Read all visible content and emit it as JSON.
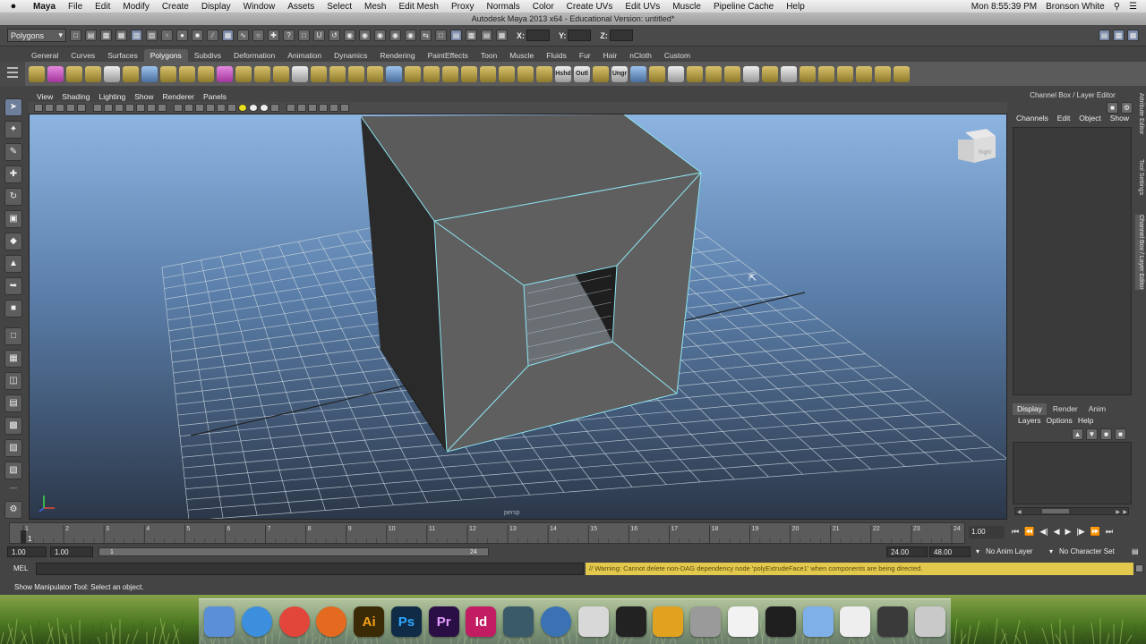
{
  "mac_menu": {
    "apple": "",
    "items": [
      "Maya",
      "File",
      "Edit",
      "Modify",
      "Create",
      "Display",
      "Window",
      "Assets",
      "Select",
      "Mesh",
      "Edit Mesh",
      "Proxy",
      "Normals",
      "Color",
      "Create UVs",
      "Edit UVs",
      "Muscle",
      "Pipeline Cache",
      "Help"
    ],
    "clock": "Mon 8:55:39 PM",
    "user": "Bronson White"
  },
  "window_title": "Autodesk Maya 2013 x64 - Educational Version: untitled*",
  "status_line": {
    "mode": "Polygons",
    "x_label": "X:",
    "y_label": "Y:",
    "z_label": "Z:"
  },
  "shelf": {
    "tabs": [
      "General",
      "Curves",
      "Surfaces",
      "Polygons",
      "Subdivs",
      "Deformation",
      "Animation",
      "Dynamics",
      "Rendering",
      "PaintEffects",
      "Toon",
      "Muscle",
      "Fluids",
      "Fur",
      "Hair",
      "nCloth",
      "Custom"
    ],
    "active_tab": "Polygons",
    "labeled_icons": [
      "Hshd",
      "Outl",
      "Ungr"
    ]
  },
  "viewport": {
    "menu": [
      "View",
      "Shading",
      "Lighting",
      "Show",
      "Renderer",
      "Panels"
    ],
    "view_cube_label": "Right",
    "camera_label": "persp"
  },
  "channel_box": {
    "title": "Channel Box / Layer Editor",
    "menu": [
      "Channels",
      "Edit",
      "Object",
      "Show"
    ]
  },
  "side_tabs": [
    "Attribute Editor",
    "Tool Settings",
    "Channel Box / Layer Editor"
  ],
  "layer_editor": {
    "tabs": [
      "Display",
      "Render",
      "Anim"
    ],
    "active_tab": "Display",
    "menu": [
      "Layers",
      "Options",
      "Help"
    ]
  },
  "time_slider": {
    "ticks": [
      1,
      2,
      3,
      4,
      5,
      6,
      7,
      8,
      9,
      10,
      11,
      12,
      13,
      14,
      15,
      16,
      17,
      18,
      19,
      20,
      21,
      22,
      23,
      24
    ],
    "current_frame": 1,
    "current_time": "1.00"
  },
  "range_slider": {
    "start": "1.00",
    "range_start": "1.00",
    "bar_start": "1",
    "bar_end": "24",
    "range_end": "24.00",
    "end": "48.00",
    "anim_layer": "No Anim Layer",
    "character_set": "No Character Set"
  },
  "command_line": {
    "label": "MEL",
    "warning": "// Warning: Cannot delete non-DAG dependency node 'polyExtrudeFace1' when components are being directed."
  },
  "help_line": "Show Manipulator Tool: Select an object.",
  "dock": {
    "icons": [
      {
        "name": "finder-icon",
        "label": "",
        "color": "#5b8fd8"
      },
      {
        "name": "safari-icon",
        "label": "",
        "color": "#3b8fdc"
      },
      {
        "name": "chrome-icon",
        "label": "",
        "color": "#e2463b"
      },
      {
        "name": "firefox-icon",
        "label": "",
        "color": "#e46a1f"
      },
      {
        "name": "illustrator-icon",
        "label": "Ai",
        "color": "#3a2a05"
      },
      {
        "name": "photoshop-icon",
        "label": "Ps",
        "color": "#0f2b46"
      },
      {
        "name": "premiere-icon",
        "label": "Pr",
        "color": "#2a0f45"
      },
      {
        "name": "indesign-icon",
        "label": "Id",
        "color": "#c21d63"
      },
      {
        "name": "maya-icon",
        "label": "",
        "color": "#3a5a6a"
      },
      {
        "name": "network-icon",
        "label": "",
        "color": "#3a72b4"
      },
      {
        "name": "preview-icon",
        "label": "",
        "color": "#d8d8d8"
      },
      {
        "name": "terminal-icon",
        "label": "",
        "color": "#222222"
      },
      {
        "name": "word-icon",
        "label": "",
        "color": "#e0a21f"
      },
      {
        "name": "utility-icon",
        "label": "",
        "color": "#9a9a9a"
      },
      {
        "name": "document-icon",
        "label": "",
        "color": "#f2f2f2"
      },
      {
        "name": "activity-icon",
        "label": "",
        "color": "#1f1f1f"
      },
      {
        "name": "folder-icon",
        "label": "",
        "color": "#7fb0e8"
      },
      {
        "name": "text-icon",
        "label": "",
        "color": "#eeeeee"
      },
      {
        "name": "drive-icon",
        "label": "",
        "color": "#3a3a3a"
      },
      {
        "name": "trash-icon",
        "label": "",
        "color": "#c9c9c9"
      }
    ]
  },
  "colors": {
    "wire_highlight": "#8ee6f4",
    "grid_line": "#c7d3dc",
    "face_gray": "#5e5e5e",
    "warning_bg": "#e2c84d"
  }
}
